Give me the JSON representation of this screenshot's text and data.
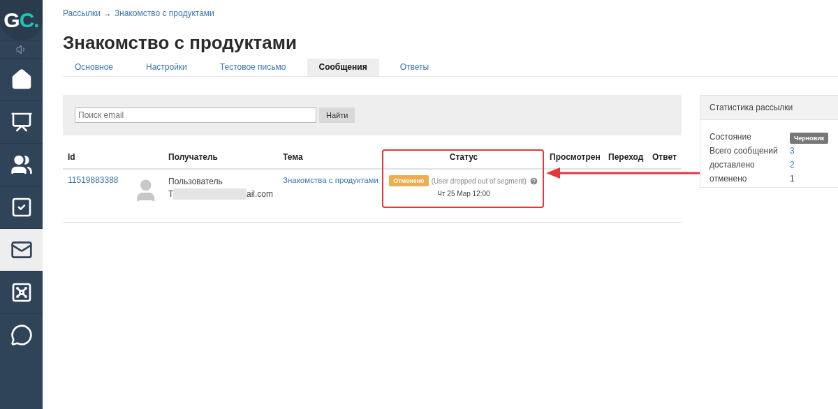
{
  "sidebar": {
    "logo": {
      "letter_1": "G",
      "letter_2": "C",
      "dot": "."
    },
    "items": [
      {
        "kind": "sound",
        "selected": false
      },
      {
        "kind": "home",
        "selected": false
      },
      {
        "kind": "chart",
        "selected": false
      },
      {
        "kind": "users",
        "selected": false
      },
      {
        "kind": "tasks",
        "selected": false
      },
      {
        "kind": "mail",
        "selected": true
      },
      {
        "kind": "safe",
        "selected": false
      },
      {
        "kind": "chat",
        "selected": false
      }
    ]
  },
  "breadcrumb": {
    "parent": "Рассылки",
    "separator": "→",
    "current": "Знакомство с продуктами"
  },
  "title": "Знакомство с продуктами",
  "tabs": [
    {
      "label": "Основное",
      "selected": false
    },
    {
      "label": "Настройки",
      "selected": false
    },
    {
      "label": "Тестовое письмо",
      "selected": false
    },
    {
      "label": "Сообщения",
      "selected": true
    },
    {
      "label": "Ответы",
      "selected": false
    }
  ],
  "search": {
    "placeholder": "Поиск email",
    "button": "Найти"
  },
  "table": {
    "columns": [
      "Id",
      "Получатель",
      "Тема",
      "Статус",
      "Просмотрен",
      "Переход",
      "Ответ"
    ],
    "rows": [
      {
        "id": "11519883388",
        "recipient_name": "Пользователь",
        "email_start": "T",
        "email_end": "ail.com",
        "topic": "Знакомства с продуктами",
        "status": "Отменено",
        "status_note": "(User dropped out of segment)",
        "status_time": "Чт 25 Мар 12:00"
      }
    ]
  },
  "stats": {
    "title": "Статистика рассылки",
    "rows": [
      {
        "label": "Состояние",
        "value": "Черновик",
        "kind": "badge"
      },
      {
        "label": "Всего сообщений",
        "value": "3",
        "kind": "link"
      },
      {
        "label": "доставлено",
        "value": "2",
        "kind": "link"
      },
      {
        "label": "отменено",
        "value": "1",
        "kind": "plain"
      }
    ]
  }
}
